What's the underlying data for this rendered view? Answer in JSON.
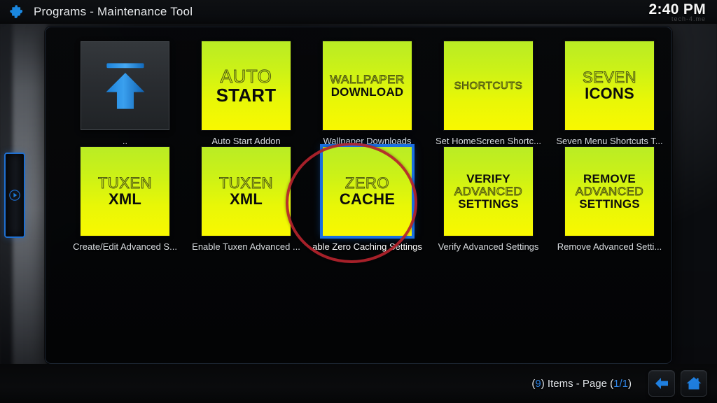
{
  "window": {
    "icon": "puzzle-piece-icon",
    "section": "Programs",
    "separator": "-",
    "title": "Maintenance Tool",
    "full_title": "Programs  -  Maintenance Tool"
  },
  "clock": {
    "time": "2:40 PM",
    "watermark": "tech-4.me"
  },
  "sidebar": {
    "expand_icon": "play-triangle-icon"
  },
  "grid": {
    "tiles": [
      {
        "id": "parent-directory",
        "kind": "parent",
        "icon": "up-arrow-icon",
        "label": "..",
        "art_lines": [],
        "selected": false
      },
      {
        "id": "auto-start-addon",
        "kind": "green",
        "label": "Auto Start Addon",
        "art_size": "lg",
        "art_lines": [
          {
            "text": "AUTO",
            "weight": "thin"
          },
          {
            "text": "START",
            "weight": "bold"
          }
        ],
        "selected": false
      },
      {
        "id": "wallpaper-downloads",
        "kind": "green",
        "label": "Wallpaper Downloads",
        "art_size": "sm",
        "art_lines": [
          {
            "text": "WALLPAPER",
            "weight": "thin"
          },
          {
            "text": "DOWNLOAD",
            "weight": "bold"
          }
        ],
        "selected": false
      },
      {
        "id": "set-homescreen-shortcuts",
        "kind": "green",
        "label": "Set HomeScreen Shortc...",
        "art_size": "xs",
        "art_lines": [
          {
            "text": "SHORTCUTS",
            "weight": "thin"
          }
        ],
        "selected": false
      },
      {
        "id": "seven-menu-shortcuts",
        "kind": "green",
        "label": "Seven Menu Shortcuts T...",
        "art_size": "md",
        "art_lines": [
          {
            "text": "SEVEN",
            "weight": "thin"
          },
          {
            "text": "ICONS",
            "weight": "bold"
          }
        ],
        "selected": false
      },
      {
        "id": "create-edit-advanced-settings",
        "kind": "green",
        "label": "Create/Edit Advanced S...",
        "art_size": "md",
        "art_lines": [
          {
            "text": "TUXEN",
            "weight": "thin"
          },
          {
            "text": "XML",
            "weight": "bold"
          }
        ],
        "selected": false
      },
      {
        "id": "enable-tuxen-advanced",
        "kind": "green",
        "label": "Enable Tuxen Advanced ...",
        "art_size": "md",
        "art_lines": [
          {
            "text": "TUXEN",
            "weight": "thin"
          },
          {
            "text": "XML",
            "weight": "bold"
          }
        ],
        "selected": false
      },
      {
        "id": "zero-caching-settings",
        "kind": "green",
        "label": "able Zero Caching Settings",
        "art_size": "md",
        "art_lines": [
          {
            "text": "ZERO",
            "weight": "thin"
          },
          {
            "text": "CACHE",
            "weight": "bold"
          }
        ],
        "selected": true
      },
      {
        "id": "verify-advanced-settings",
        "kind": "green",
        "label": "Verify Advanced Settings",
        "art_size": "sm",
        "art_lines": [
          {
            "text": "VERIFY",
            "weight": "bold"
          },
          {
            "text": "ADVANCED",
            "weight": "thin"
          },
          {
            "text": "SETTINGS",
            "weight": "bold"
          }
        ],
        "selected": false
      },
      {
        "id": "remove-advanced-settings",
        "kind": "green",
        "label": "Remove Advanced Setti...",
        "art_size": "sm",
        "art_lines": [
          {
            "text": "REMOVE",
            "weight": "bold"
          },
          {
            "text": "ADVANCED",
            "weight": "thin"
          },
          {
            "text": "SETTINGS",
            "weight": "bold"
          }
        ],
        "selected": false
      }
    ]
  },
  "annotation": {
    "shape": "circle",
    "color": "#b4232c",
    "targets": "zero-caching-settings"
  },
  "statusbar": {
    "item_count": "9",
    "items_text": "Items - Page",
    "page": "1/1",
    "full_text": "(9) Items - Page (1/1)",
    "back_button": "back-arrow-icon",
    "home_button": "home-icon"
  },
  "colors": {
    "accent_blue": "#2f86e8",
    "selection_blue": "#1a6fe0",
    "tile_green_top": "#b9ec25",
    "tile_yellow_bottom": "#f9f800",
    "annotation_red": "#b4232c",
    "text_primary": "#e9ecef"
  }
}
